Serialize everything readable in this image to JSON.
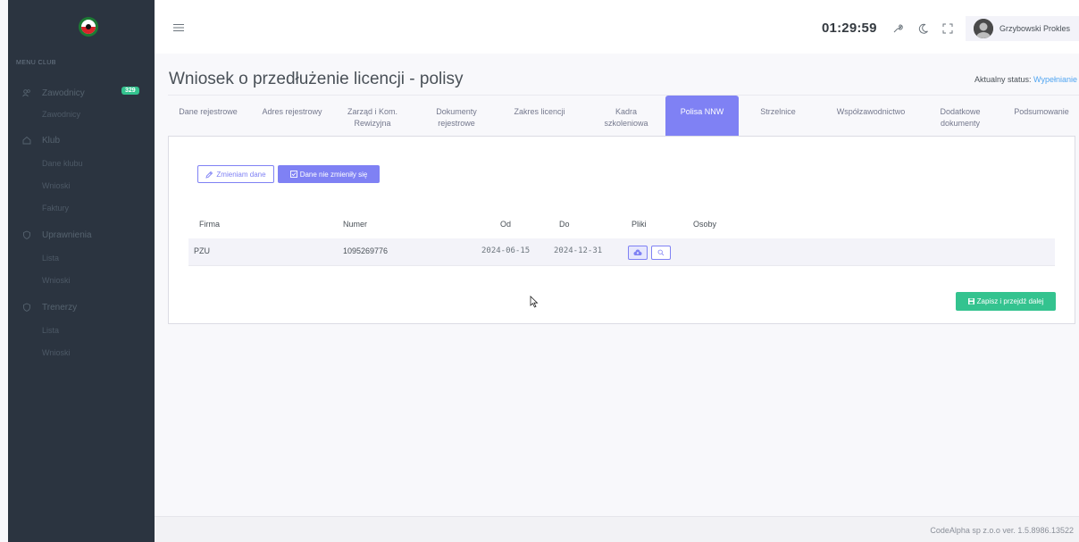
{
  "sidebar": {
    "menu_title": "MENU CLUB",
    "items": [
      {
        "label": "Zawodnicy",
        "icon": "users-icon",
        "badge": "329",
        "children": [
          "Zawodnicy"
        ]
      },
      {
        "label": "Klub",
        "icon": "home-icon",
        "children": [
          "Dane klubu",
          "Wnioski",
          "Faktury"
        ]
      },
      {
        "label": "Uprawnienia",
        "icon": "shield-icon",
        "children": [
          "Lista",
          "Wnioski"
        ]
      },
      {
        "label": "Trenerzy",
        "icon": "shield-icon",
        "children": [
          "Lista",
          "Wnioski"
        ]
      }
    ]
  },
  "topbar": {
    "clock": "01:29:59",
    "user_name": "Grzybowski Prokles",
    "icons": [
      "wrench-icon",
      "moon-icon",
      "fullscreen-icon"
    ]
  },
  "page": {
    "title": "Wniosek o przedłużenie licencji - polisy",
    "status_label": "Aktualny status:",
    "status_value": "Wypełnianie"
  },
  "tabs": [
    {
      "label": "Dane rejestrowe"
    },
    {
      "label": "Adres rejestrowy"
    },
    {
      "label": "Zarząd i Kom. Rewizyjna"
    },
    {
      "label": "Dokumenty rejestrowe"
    },
    {
      "label": "Zakres licencji"
    },
    {
      "label": "Kadra szkoleniowa"
    },
    {
      "label": "Polisa NNW",
      "active": true
    },
    {
      "label": "Strzelnice"
    },
    {
      "label": "Współzawodnictwo"
    },
    {
      "label": "Dodatkowe dokumenty"
    },
    {
      "label": "Podsumowanie"
    }
  ],
  "actions": {
    "change_label": "Zmieniam dane",
    "no_change_label": "Dane nie zmieniły się",
    "save_label": "Zapisz i przejdź dalej"
  },
  "table": {
    "headers": [
      "Firma",
      "Numer",
      "Od",
      "Do",
      "Pliki",
      "Osoby"
    ],
    "rows": [
      {
        "firma": "PZU",
        "numer": "1095269776",
        "od": "2024-06-15",
        "do": "2024-12-31"
      }
    ]
  },
  "footer": {
    "text": "CodeAlpha sp z.o.o ver. 1.5.8986.13522"
  },
  "colors": {
    "sidebar_bg": "#2b3440",
    "accent": "#7f81f4",
    "success": "#34c38f",
    "status": "#50a5f1"
  }
}
